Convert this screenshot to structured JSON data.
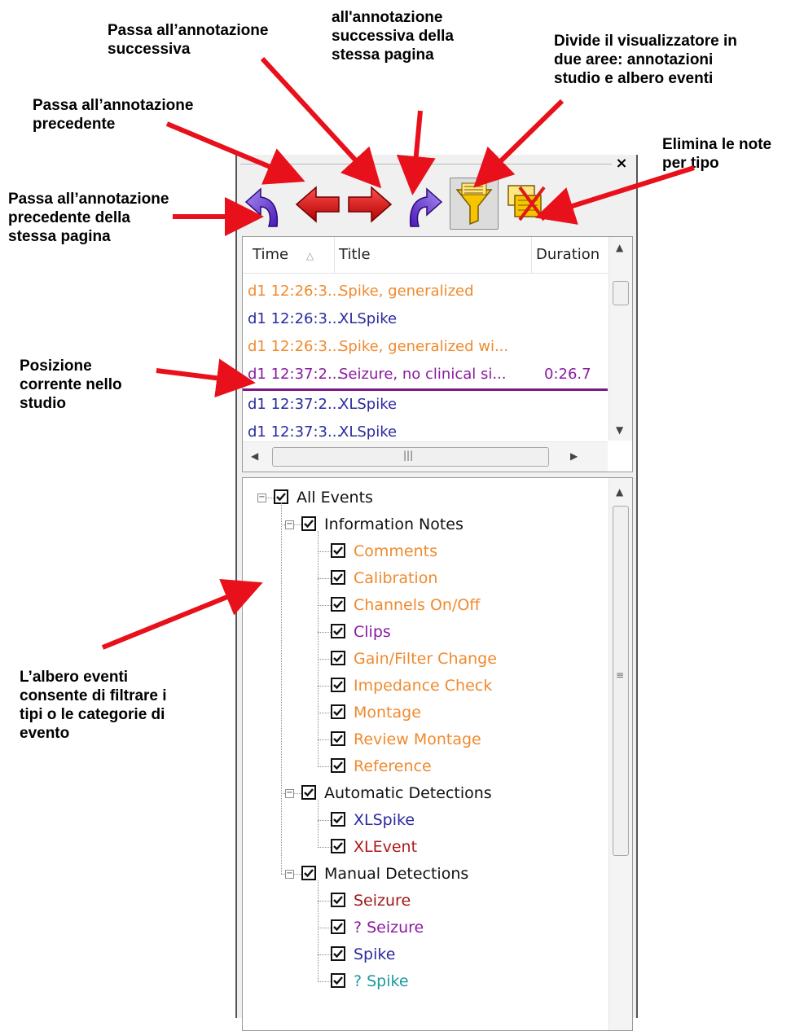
{
  "callouts": {
    "next_annotation": "Passa all’annotazione\nsuccessiva",
    "next_same_page": "all'annotazione\nsuccessiva della\nstessa pagina",
    "split_viewer": "Divide il visualizzatore in\ndue aree: annotazioni\nstudio e albero eventi",
    "previous_annotation": "Passa all’annotazione\nprecedente",
    "delete_by_type": "Elimina le note\nper tipo",
    "previous_same_page": "Passa all’annotazione\nprecedente della\nstessa pagina",
    "current_position": "Posizione\ncorrente nello\nstudio",
    "event_tree": "L’albero eventi\nconsente di filtrare i\ntipi o le categorie di\nevento"
  },
  "panel": {
    "close_glyph": "×"
  },
  "list": {
    "headers": {
      "time": "Time",
      "title": "Title",
      "duration": "Duration"
    },
    "rows": [
      {
        "time": "d1 12:26:3...",
        "title": "Spike, generalized",
        "duration": "",
        "color": "#f08a2e"
      },
      {
        "time": "d1 12:26:3...",
        "title": "XLSpike",
        "duration": "",
        "color": "#2a2aa0"
      },
      {
        "time": "d1 12:26:3...",
        "title": "Spike, generalized wi...",
        "duration": "",
        "color": "#f08a2e"
      },
      {
        "time": "d1 12:37:2...",
        "title": "Seizure, no clinical si...",
        "duration": "0:26.7",
        "color": "#8a1aa0"
      },
      {
        "time": "d1 12:37:2...",
        "title": "XLSpike",
        "duration": "",
        "color": "#2a2aa0"
      },
      {
        "time": "d1 12:37:3...",
        "title": "XLSpike",
        "duration": "",
        "color": "#2a2aa0"
      }
    ],
    "current_index": 3
  },
  "tree": {
    "root": "All Events",
    "groups": [
      {
        "label": "Information Notes",
        "items": [
          {
            "label": "Comments",
            "color": "#f08a2e"
          },
          {
            "label": "Calibration",
            "color": "#f08a2e"
          },
          {
            "label": "Channels On/Off",
            "color": "#f08a2e"
          },
          {
            "label": "Clips",
            "color": "#8a1aa0"
          },
          {
            "label": "Gain/Filter Change",
            "color": "#f08a2e"
          },
          {
            "label": "Impedance Check",
            "color": "#f08a2e"
          },
          {
            "label": "Montage",
            "color": "#f08a2e"
          },
          {
            "label": "Review Montage",
            "color": "#f08a2e"
          },
          {
            "label": "Reference",
            "color": "#f08a2e"
          }
        ]
      },
      {
        "label": "Automatic Detections",
        "items": [
          {
            "label": "XLSpike",
            "color": "#2a2aa0"
          },
          {
            "label": "XLEvent",
            "color": "#b01818"
          }
        ]
      },
      {
        "label": "Manual Detections",
        "items": [
          {
            "label": "Seizure",
            "color": "#a01818"
          },
          {
            "label": "? Seizure",
            "color": "#8a1aa0"
          },
          {
            "label": "Spike",
            "color": "#2a2aa0"
          },
          {
            "label": "? Spike",
            "color": "#1a9aa0"
          }
        ]
      }
    ]
  },
  "icons": {
    "prev_same_page": "curved-arrow-left-icon",
    "prev": "arrow-left-icon",
    "next": "arrow-right-icon",
    "next_same_page": "curved-arrow-right-icon",
    "split": "funnel-notes-icon",
    "delete": "delete-notes-icon"
  },
  "colors": {
    "arrow": "#e8101a",
    "current_line": "#7a1a85"
  }
}
